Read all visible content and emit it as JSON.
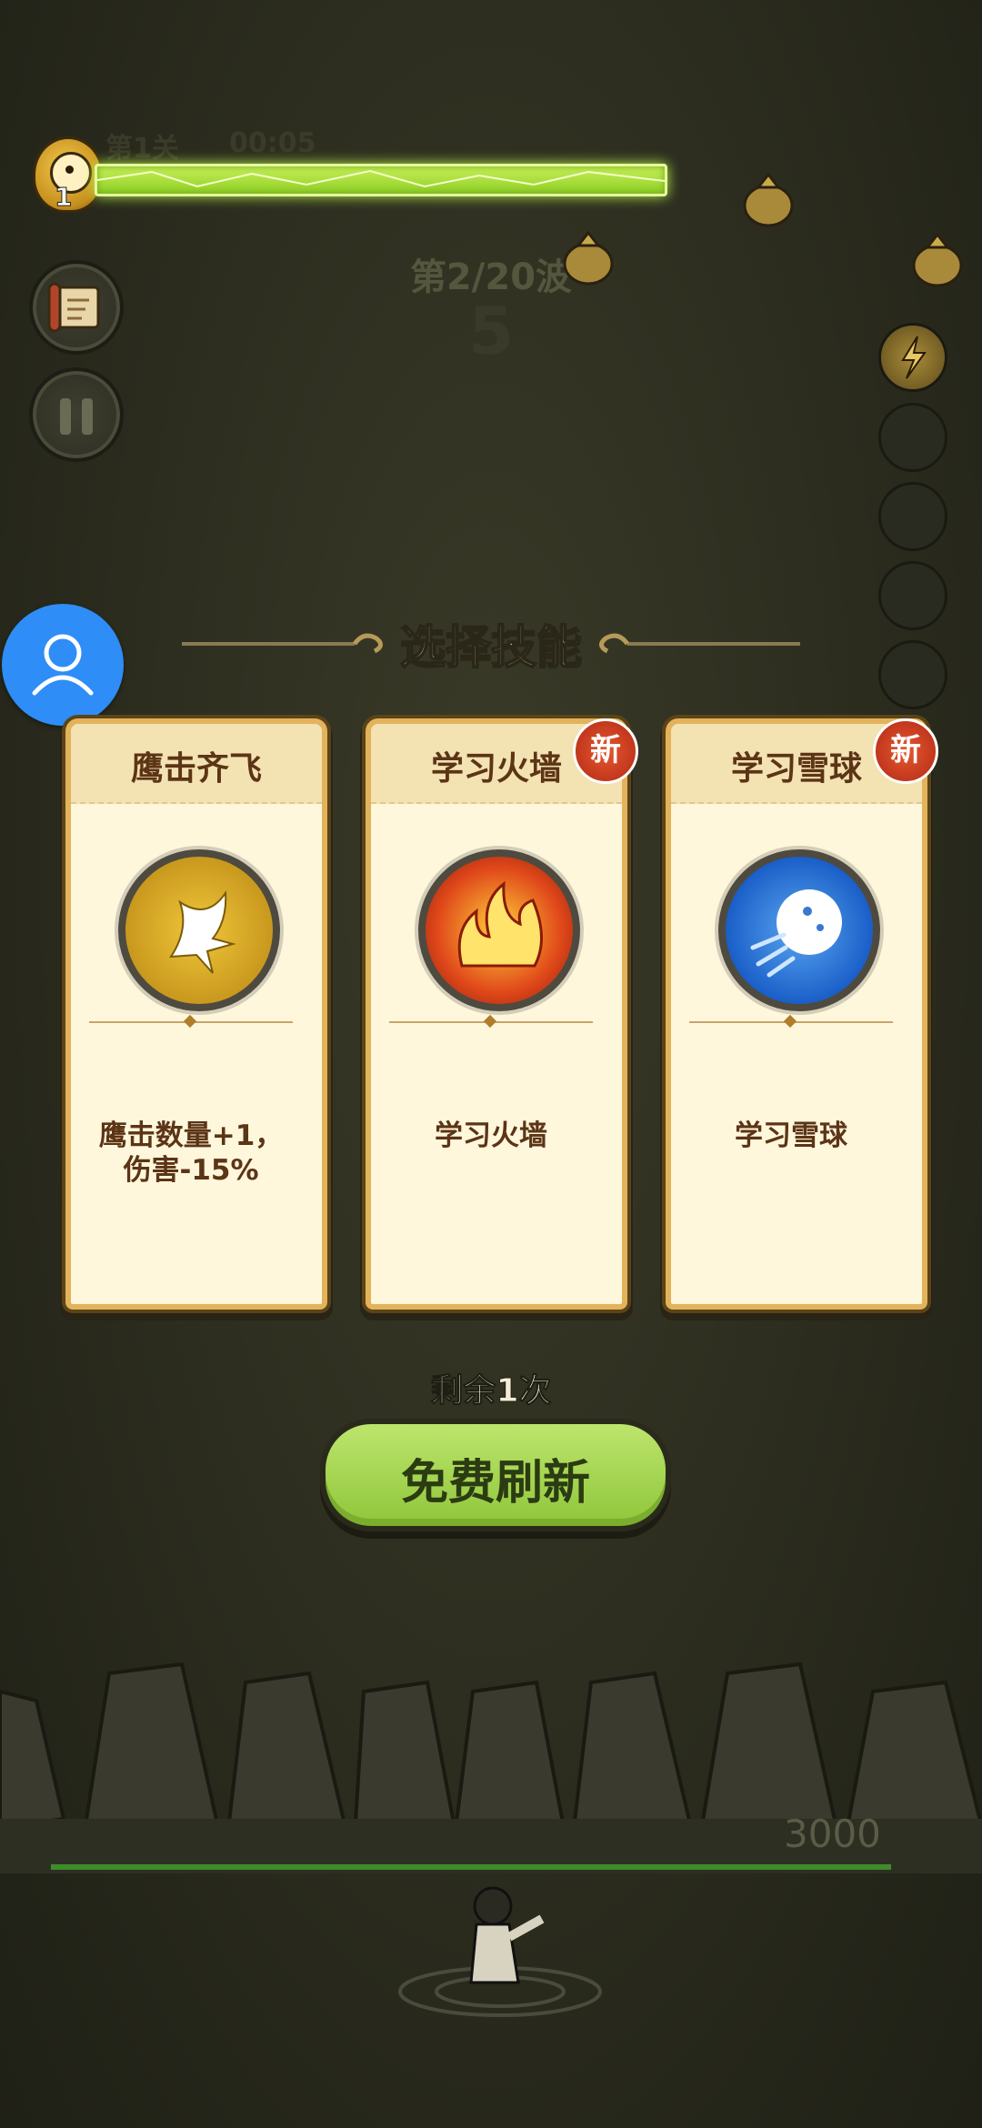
{
  "hud": {
    "level_number": "1",
    "stage_label": "第1关",
    "timer": "00:05",
    "wave_label": "第2/20波",
    "countdown": "5",
    "xp_progress": 1.0
  },
  "side_buttons": {
    "scroll_icon": "scroll-icon",
    "pause_icon": "pause-icon"
  },
  "skill_slots": {
    "count": 5,
    "active_index": 0
  },
  "panel": {
    "title": "选择技能",
    "cards": [
      {
        "name": "鹰击齐飞",
        "icon": "eagle-icon",
        "desc": "鹰击数量+1，\n伤害-15%",
        "is_new": false,
        "icon_color": "#d9a620"
      },
      {
        "name": "学习火墙",
        "icon": "fire-icon",
        "desc": "学习火墙",
        "is_new": true,
        "icon_color": "#e3461a"
      },
      {
        "name": "学习雪球",
        "icon": "snowball-icon",
        "desc": "学习雪球",
        "is_new": true,
        "icon_color": "#1f6fd6"
      }
    ],
    "new_badge": "新"
  },
  "footer": {
    "remaining": "剩余1次",
    "refresh_label": "免费刷新",
    "wall_hp": "3000"
  },
  "colors": {
    "xp_bar": "#a6df3a",
    "card_border": "#e3b35b",
    "button_green": "#a8d655",
    "avatar_blue": "#2e8df6"
  }
}
